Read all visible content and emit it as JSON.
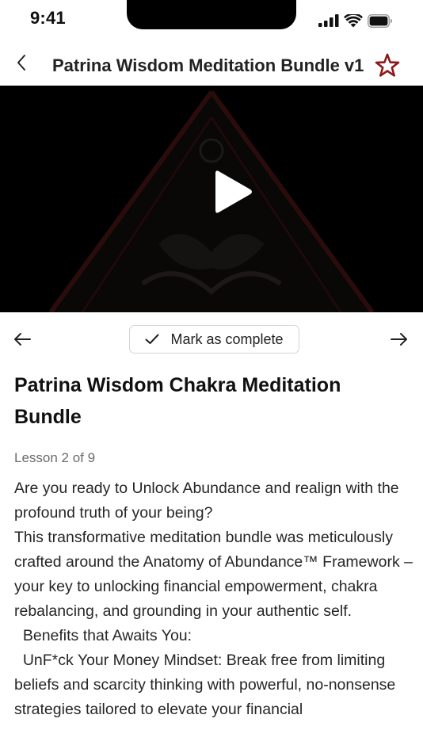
{
  "status_bar": {
    "time": "9:41",
    "icons": [
      "signal-icon",
      "wifi-icon",
      "battery-icon"
    ]
  },
  "nav": {
    "title": "Patrina Wisdom Meditation Bundle v1",
    "back_icon": "chevron-left-icon",
    "favorite_icon": "star-outline-icon"
  },
  "video": {
    "play_icon": "play-icon"
  },
  "controls": {
    "prev_icon": "arrow-left-icon",
    "next_icon": "arrow-right-icon",
    "complete_label": "Mark as complete",
    "check_icon": "check-icon"
  },
  "lesson": {
    "title": "Patrina Wisdom Chakra Meditation Bundle",
    "progress": "Lesson 2 of 9",
    "paragraphs": [
      "Are you ready to Unlock Abundance and realign with the profound truth of your being?",
      "This transformative meditation bundle was meticulously crafted around the Anatomy of Abundance™ Framework – your key to unlocking financial empowerment, chakra rebalancing, and grounding in your authentic self.",
      "  Benefits that Awaits You:",
      "  UnF*ck Your Money Mindset: Break free from limiting beliefs and scarcity thinking with powerful, no-nonsense strategies tailored to elevate your financial"
    ]
  },
  "colors": {
    "accent_star": "#8b1a1a",
    "video_bg": "#000000",
    "muted_text": "#6b6b6b"
  }
}
